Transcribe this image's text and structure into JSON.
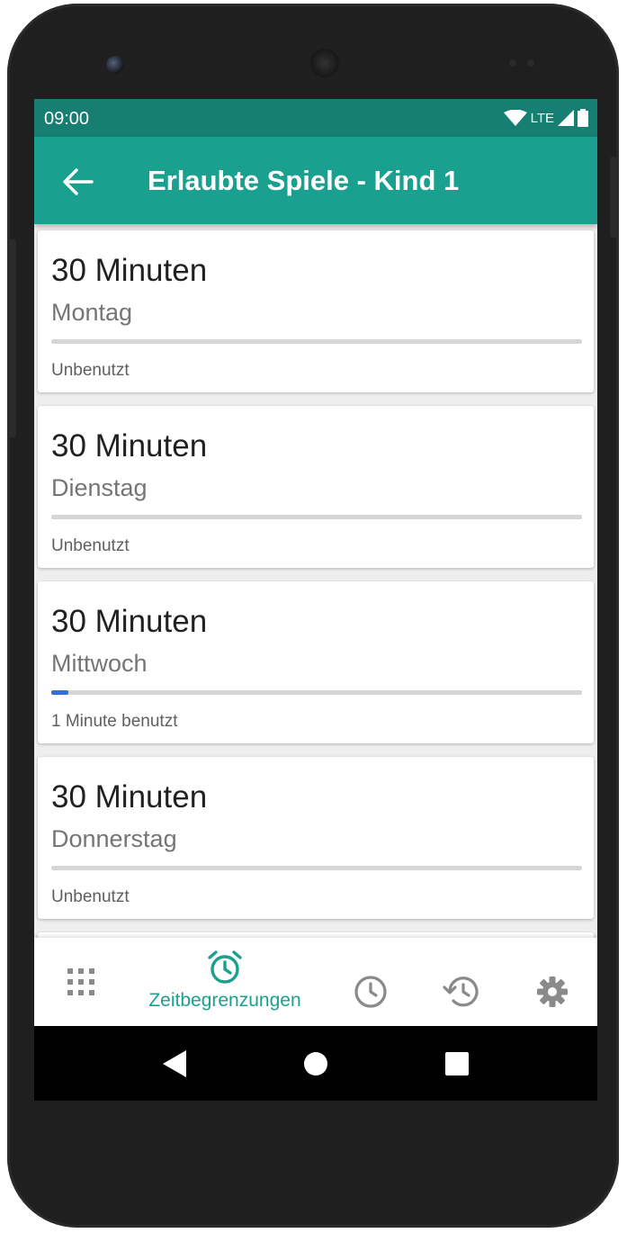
{
  "status_bar": {
    "time": "09:00",
    "network": "LTE"
  },
  "app_bar": {
    "title": "Erlaubte Spiele - Kind 1",
    "back_icon": "arrow-back-icon"
  },
  "days": [
    {
      "limit": "30 Minuten",
      "day": "Montag",
      "usage": "Unbenutzt",
      "progress": 0
    },
    {
      "limit": "30 Minuten",
      "day": "Dienstag",
      "usage": "Unbenutzt",
      "progress": 0
    },
    {
      "limit": "30 Minuten",
      "day": "Mittwoch",
      "usage": "1 Minute benutzt",
      "progress": 0.033
    },
    {
      "limit": "30 Minuten",
      "day": "Donnerstag",
      "usage": "Unbenutzt",
      "progress": 0
    }
  ],
  "bottom_nav": {
    "items": [
      {
        "icon": "apps-grid-icon",
        "label": ""
      },
      {
        "icon": "alarm-clock-icon",
        "label": "Zeitbegrenzungen",
        "active": true
      },
      {
        "icon": "clock-icon",
        "label": ""
      },
      {
        "icon": "history-icon",
        "label": ""
      },
      {
        "icon": "gear-icon",
        "label": ""
      }
    ]
  },
  "system_nav": [
    "back-triangle-icon",
    "home-circle-icon",
    "recents-square-icon"
  ],
  "colors": {
    "primary": "#1aa08e",
    "primary_dark": "#167f71",
    "progress": "#2f71d6",
    "inactive_icon": "#8a8a8a"
  }
}
